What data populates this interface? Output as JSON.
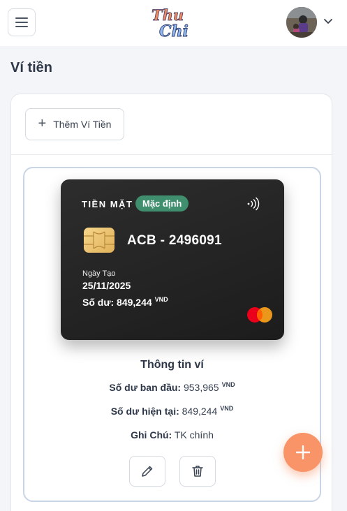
{
  "header": {
    "logo_line1": "Thu",
    "logo_line2": "Chi"
  },
  "page": {
    "title": "Ví tiền"
  },
  "toolbar": {
    "add_wallet_label": "Thêm Ví Tiền"
  },
  "card": {
    "type_label": "TIỀN MẶT",
    "badge": "Mặc định",
    "name": "ACB - 2496091",
    "created_label": "Ngày Tạo",
    "created_date": "25/11/2025",
    "balance_label": "Số dư:",
    "balance_value": "849,244",
    "currency": "VND"
  },
  "info": {
    "title": "Thông tin ví",
    "initial_label": "Số dư ban đầu:",
    "initial_value": "953,965",
    "current_label": "Số dư hiện tại:",
    "current_value": "849,244",
    "currency": "VND",
    "note_label": "Ghi Chú:",
    "note_value": "TK chính"
  },
  "colors": {
    "badge": "#3f8f6e",
    "fab": "#f99368",
    "card": "#262626",
    "wallet_border": "#c9d5e6"
  },
  "icons": [
    "menu-icon",
    "chevron-down-icon",
    "plus-icon",
    "nfc-icon",
    "chip-icon",
    "mastercard-icon",
    "pencil-icon",
    "trash-icon"
  ]
}
